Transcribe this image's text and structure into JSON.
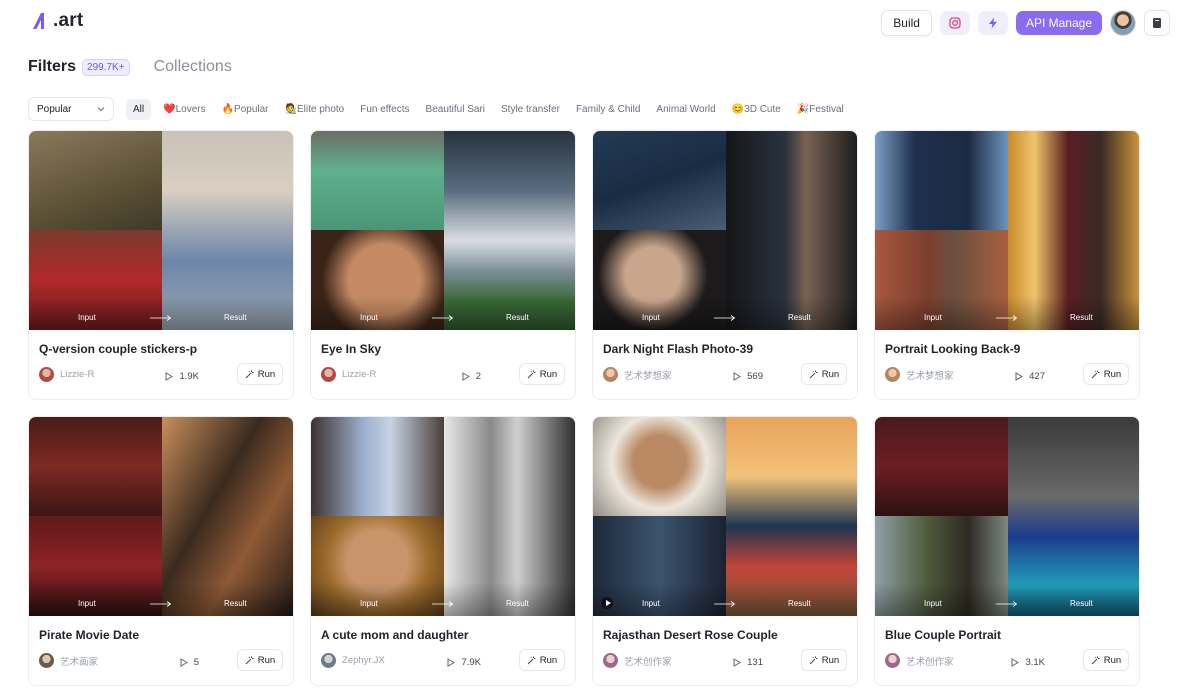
{
  "header": {
    "logo_text": ".art",
    "build_label": "Build",
    "api_label": "API Manage",
    "accent_color": "#8b6cf0"
  },
  "tabs": {
    "filters_label": "Filters",
    "filters_count": "299.7K+",
    "collections_label": "Collections"
  },
  "sort": {
    "selected": "Popular"
  },
  "chips": [
    {
      "label": "All",
      "active": true
    },
    {
      "label": "❤️Lovers"
    },
    {
      "label": "🔥Popular"
    },
    {
      "label": "🧑‍🎨Elite photo"
    },
    {
      "label": "Fun effects"
    },
    {
      "label": "Beautiful Sari"
    },
    {
      "label": "Style transfer"
    },
    {
      "label": "Family & Child"
    },
    {
      "label": "Animal World"
    },
    {
      "label": "😊3D Cute"
    },
    {
      "label": "🎉Festival"
    }
  ],
  "thumb_labels": {
    "input": "Input",
    "result": "Result"
  },
  "run_label": "Run",
  "cards": [
    {
      "title": "Q-version couple stickers-p",
      "author": "Lizzie-R",
      "runs": "1.9K"
    },
    {
      "title": "Eye In Sky",
      "author": "Lizzie-R",
      "runs": "2"
    },
    {
      "title": "Dark Night Flash Photo-39",
      "author": "艺术梦想家",
      "runs": "569"
    },
    {
      "title": "Portrait Looking Back-9",
      "author": "艺术梦想家",
      "runs": "427"
    },
    {
      "title": "Pirate Movie Date",
      "author": "艺术画家",
      "runs": "5"
    },
    {
      "title": "A cute mom and daughter",
      "author": "Zephyr.JX",
      "runs": "7.9K"
    },
    {
      "title": "Rajasthan Desert Rose Couple",
      "author": "艺术创作家",
      "runs": "131"
    },
    {
      "title": "Blue Couple Portrait",
      "author": "艺术创作家",
      "runs": "3.1K"
    }
  ]
}
